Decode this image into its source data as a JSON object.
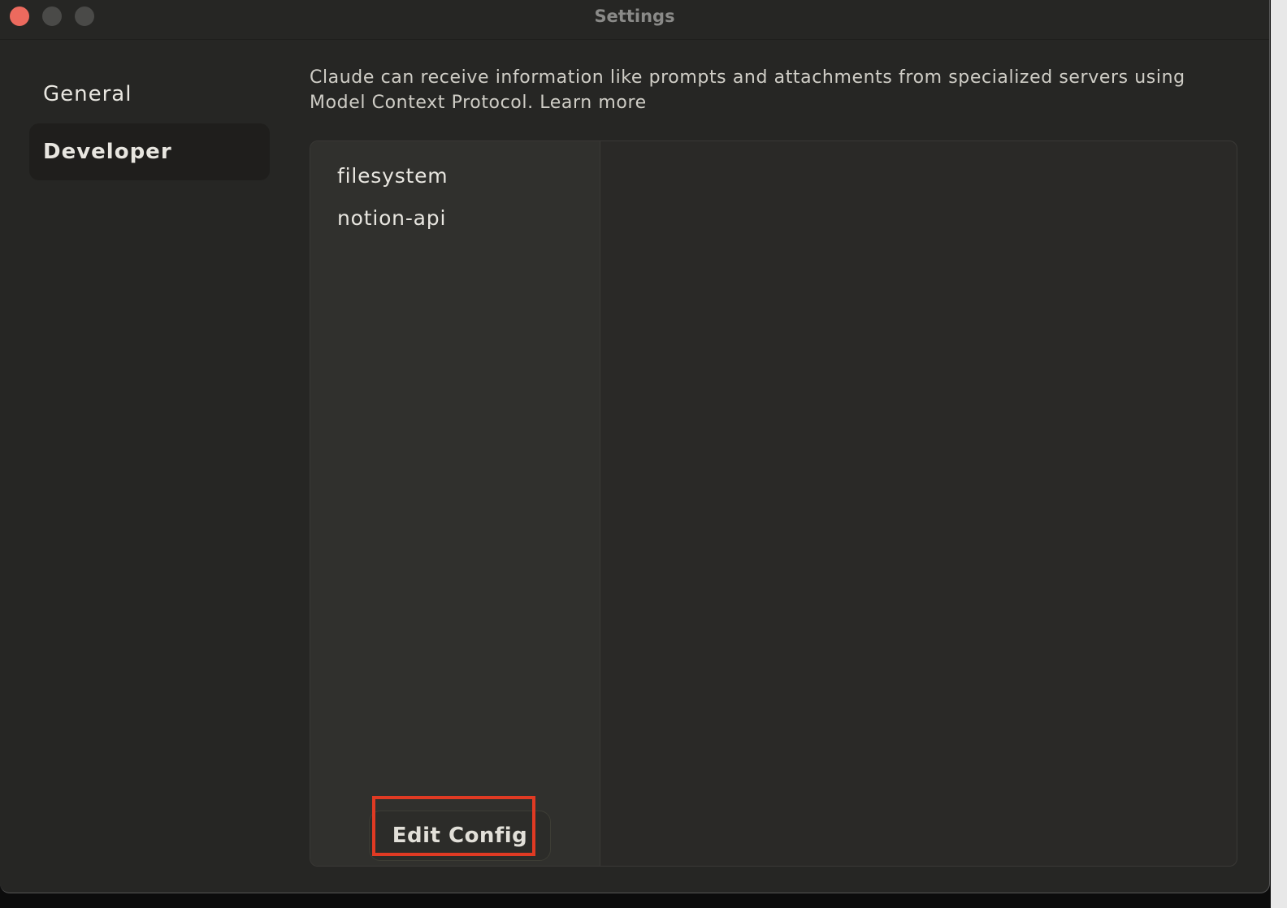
{
  "window": {
    "title": "Settings",
    "traffic_lights": {
      "close_color": "#ec6a5e",
      "inactive_color": "#4a4a48"
    }
  },
  "sidebar": {
    "items": [
      {
        "label": "General",
        "active": false
      },
      {
        "label": "Developer",
        "active": true
      }
    ]
  },
  "main": {
    "description": "Claude can receive information like prompts and attachments from specialized servers using Model Context Protocol.",
    "learn_more": "Learn more",
    "servers": [
      "filesystem",
      "notion-api"
    ],
    "edit_config_label": "Edit Config"
  },
  "colors": {
    "highlight": "#e03a23"
  }
}
